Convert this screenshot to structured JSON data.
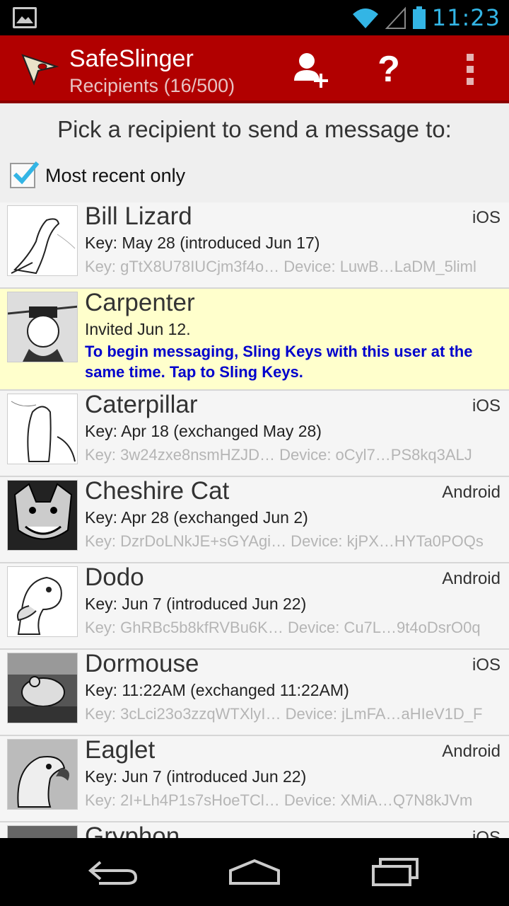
{
  "status_bar": {
    "time": "11:23"
  },
  "action_bar": {
    "title": "SafeSlinger",
    "subtitle": "Recipients (16/500)",
    "help_label": "?"
  },
  "prompt": "Pick a recipient to send a message to:",
  "filter": {
    "label": "Most recent only",
    "checked": true
  },
  "recipients": [
    {
      "name": "Bill Lizard",
      "platform": "iOS",
      "key": "Key: May 28 (introduced Jun 17)",
      "ids": "Key: gTtX8U78IUCjm3f4o… Device: LuwB…LaDM_5liml"
    },
    {
      "name": "Carpenter",
      "status": "Invited Jun 12.",
      "message": "To begin messaging, Sling Keys with this user at the same time. Tap to Sling Keys."
    },
    {
      "name": "Caterpillar",
      "platform": "iOS",
      "key": "Key: Apr 18 (exchanged May 28)",
      "ids": "Key: 3w24zxe8nsmHZJD… Device: oCyl7…PS8kq3ALJ"
    },
    {
      "name": "Cheshire Cat",
      "platform": "Android",
      "key": "Key: Apr 28 (exchanged Jun 2)",
      "ids": "Key: DzrDoLNkJE+sGYAgi… Device: kjPX…HYTa0POQs"
    },
    {
      "name": "Dodo",
      "platform": "Android",
      "key": "Key: Jun 7 (introduced Jun 22)",
      "ids": "Key: GhRBc5b8kfRVBu6K… Device: Cu7L…9t4oDsrO0q"
    },
    {
      "name": "Dormouse",
      "platform": "iOS",
      "key": "Key: 11:22AM (exchanged 11:22AM)",
      "ids": "Key: 3cLci23o3zzqWTXlyI… Device: jLmFA…aHIeV1D_F"
    },
    {
      "name": "Eaglet",
      "platform": "Android",
      "key": "Key: Jun 7 (introduced Jun 22)",
      "ids": "Key: 2I+Lh4P1s7sHoeTCl… Device: XMiA…Q7N8kJVm"
    },
    {
      "name": "Gryphon",
      "platform": "iOS"
    }
  ],
  "colors": {
    "action_bar": "#b10000",
    "accent": "#33b5e5",
    "invite_text": "#0000cc",
    "pending_row": "#ffffcc"
  }
}
